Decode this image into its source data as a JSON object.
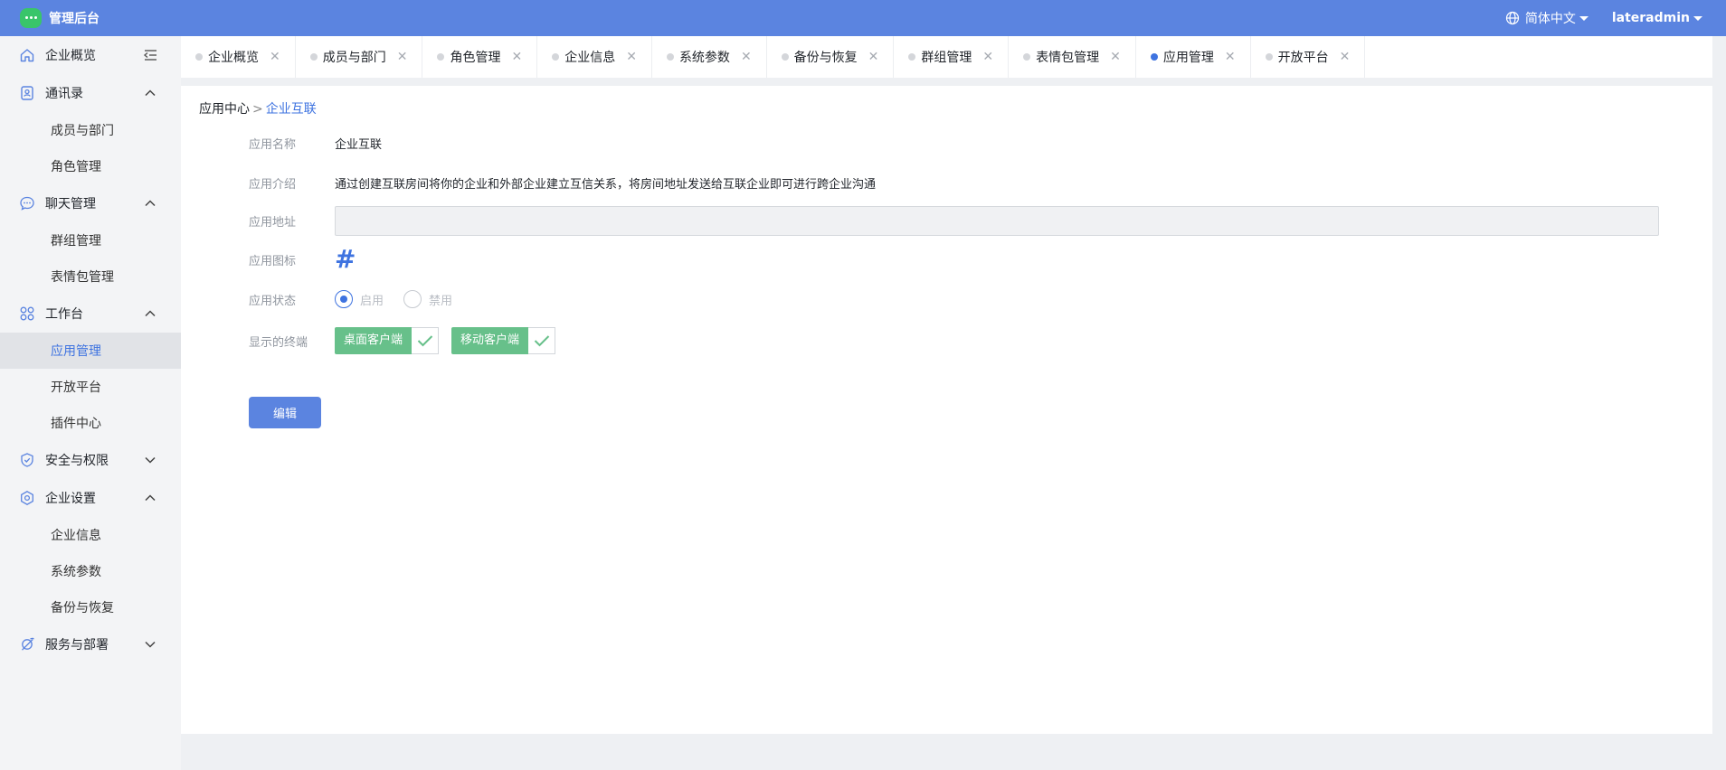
{
  "app": {
    "title": "管理后台",
    "language": "简体中文",
    "user": "lateradmin",
    "accent": "#5b84e0"
  },
  "sidebar": {
    "groups": [
      {
        "label": "企业概览",
        "icon": "home-icon"
      },
      {
        "label": "通讯录",
        "icon": "contacts-icon",
        "items": [
          "成员与部门",
          "角色管理"
        ]
      },
      {
        "label": "聊天管理",
        "icon": "chat-icon",
        "items": [
          "群组管理",
          "表情包管理"
        ]
      },
      {
        "label": "工作台",
        "icon": "workbench-icon",
        "items": [
          "应用管理",
          "开放平台",
          "插件中心"
        ]
      },
      {
        "label": "安全与权限",
        "icon": "shield-icon"
      },
      {
        "label": "企业设置",
        "icon": "settings-icon",
        "items": [
          "企业信息",
          "系统参数",
          "备份与恢复"
        ]
      },
      {
        "label": "服务与部署",
        "icon": "planet-icon"
      }
    ],
    "active_item": "应用管理"
  },
  "tabs": [
    {
      "label": "企业概览"
    },
    {
      "label": "成员与部门"
    },
    {
      "label": "角色管理"
    },
    {
      "label": "企业信息"
    },
    {
      "label": "系统参数"
    },
    {
      "label": "备份与恢复"
    },
    {
      "label": "群组管理"
    },
    {
      "label": "表情包管理"
    },
    {
      "label": "应用管理",
      "active": true
    },
    {
      "label": "开放平台"
    }
  ],
  "breadcrumb": {
    "parent": "应用中心",
    "separator": ">",
    "current": "企业互联"
  },
  "form": {
    "name_label": "应用名称",
    "name_value": "企业互联",
    "intro_label": "应用介绍",
    "intro_value": "通过创建互联房间将你的企业和外部企业建立互信关系，将房间地址发送给互联企业即可进行跨企业沟通",
    "address_label": "应用地址",
    "address_value": "",
    "icon_label": "应用图标",
    "icon_glyph": "#",
    "status_label": "应用状态",
    "status_enabled": "启用",
    "status_disabled": "禁用",
    "status_selected": "启用",
    "terminals_label": "显示的终端",
    "terminals": [
      {
        "label": "桌面客户端",
        "checked": true
      },
      {
        "label": "移动客户端",
        "checked": true
      }
    ],
    "edit_button": "编辑"
  }
}
